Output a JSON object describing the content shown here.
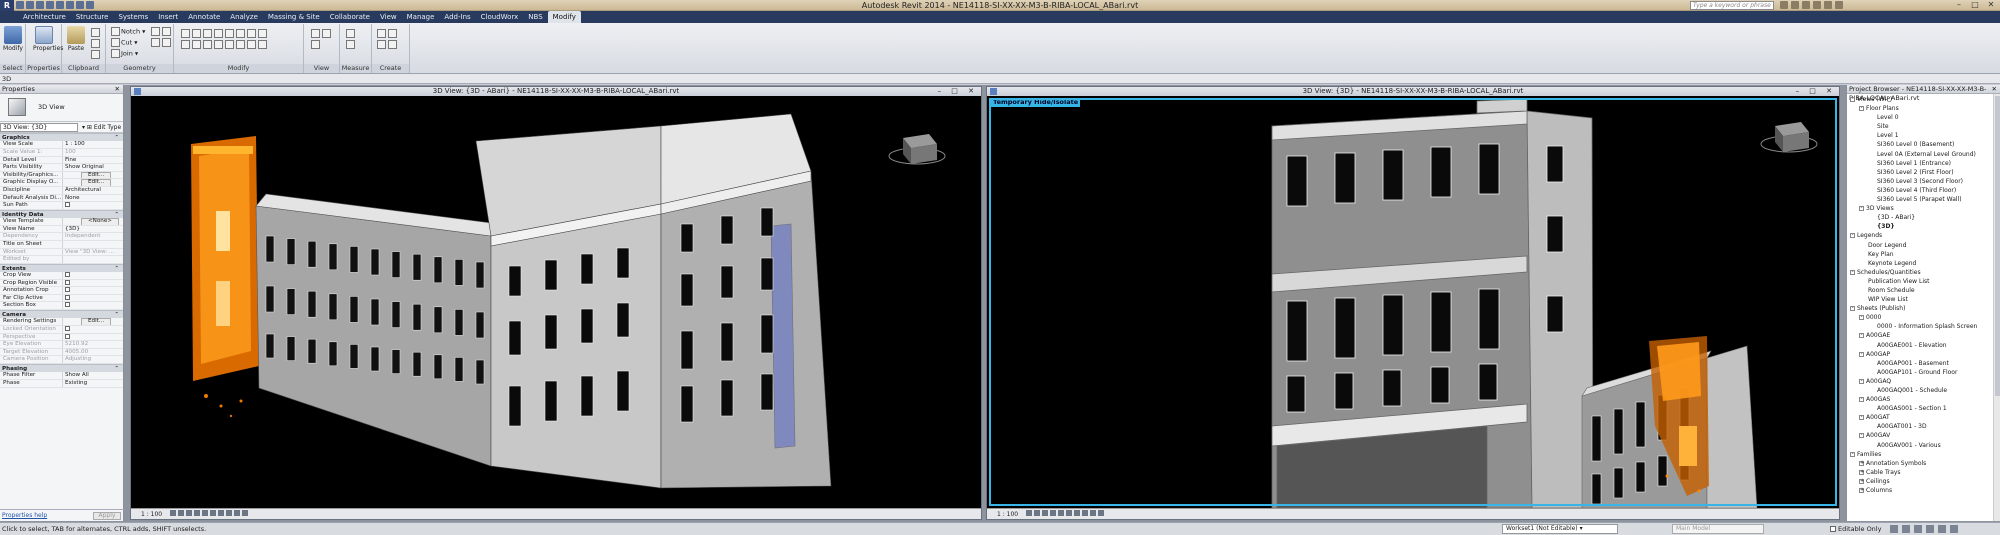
{
  "app": {
    "title": "Autodesk Revit 2014 -   NE14118-SI-XX-XX-M3-B-RIBA-LOCAL_ABari.rvt",
    "logo": "R",
    "help_search_placeholder": "Type a keyword or phrase"
  },
  "ribbon": {
    "tabs": [
      "Architecture",
      "Structure",
      "Systems",
      "Insert",
      "Annotate",
      "Analyze",
      "Massing & Site",
      "Collaborate",
      "View",
      "Manage",
      "Add-Ins",
      "CloudWorx",
      "NBS",
      "Modify"
    ],
    "active_tab": "Modify",
    "groups": {
      "select": "Select",
      "properties": "Properties",
      "clipboard": "Clipboard",
      "geometry": "Geometry",
      "modify": "Modify",
      "view": "View",
      "measure": "Measure",
      "create": "Create"
    },
    "buttons": {
      "modify": "Modify",
      "properties": "Properties",
      "paste": "Paste",
      "notch": "Notch",
      "cut": "Cut",
      "join": "Join"
    }
  },
  "context_bar": {
    "label": "3D"
  },
  "properties": {
    "header": "Properties",
    "type_name": "3D View",
    "instance_selector": "3D View: {3D}",
    "edit_type": "Edit Type",
    "sections": [
      {
        "name": "Graphics",
        "rows": [
          [
            "View Scale",
            "1 : 100"
          ],
          [
            "Scale Value    1:",
            "100"
          ],
          [
            "Detail Level",
            "Fine"
          ],
          [
            "Parts Visibility",
            "Show Original"
          ],
          [
            "Visibility/Graphics...",
            "Edit..."
          ],
          [
            "Graphic Display O...",
            "Edit..."
          ],
          [
            "Discipline",
            "Architectural"
          ],
          [
            "Default Analysis Di...",
            "None"
          ],
          [
            "Sun Path",
            ""
          ]
        ]
      },
      {
        "name": "Identity Data",
        "rows": [
          [
            "View Template",
            "<None>"
          ],
          [
            "View Name",
            "{3D}"
          ],
          [
            "Dependency",
            "Independent"
          ],
          [
            "Title on Sheet",
            ""
          ],
          [
            "Workset",
            "View \"3D View: ..."
          ],
          [
            "Edited by",
            ""
          ]
        ]
      },
      {
        "name": "Extents",
        "rows": [
          [
            "Crop View",
            ""
          ],
          [
            "Crop Region Visible",
            ""
          ],
          [
            "Annotation Crop",
            ""
          ],
          [
            "Far Clip Active",
            ""
          ],
          [
            "Section Box",
            ""
          ]
        ]
      },
      {
        "name": "Camera",
        "rows": [
          [
            "Rendering Settings",
            "Edit..."
          ],
          [
            "Locked Orientation",
            ""
          ],
          [
            "Perspective",
            ""
          ],
          [
            "Eye Elevation",
            "5210.92"
          ],
          [
            "Target Elevation",
            "4005.00"
          ],
          [
            "Camera Position",
            "Adjusting"
          ]
        ]
      },
      {
        "name": "Phasing",
        "rows": [
          [
            "Phase Filter",
            "Show All"
          ],
          [
            "Phase",
            "Existing"
          ]
        ]
      }
    ],
    "help_link": "Properties help",
    "apply": "Apply"
  },
  "views": {
    "left": {
      "title": "3D View: {3D - ABari} - NE14118-SI-XX-XX-M3-B-RIBA-LOCAL_ABari.rvt",
      "scale": "1 : 100"
    },
    "right": {
      "title": "3D View: {3D} - NE14118-SI-XX-XX-M3-B-RIBA-LOCAL_ABari.rvt",
      "scale": "1 : 100",
      "badge": "Temporary Hide/Isolate"
    }
  },
  "project_browser": {
    "header": "Project Browser - NE14118-SI-XX-XX-M3-B-RIBA-LOCAL_ABari.rvt",
    "items": [
      {
        "label": "Views (WIP)",
        "level": 0,
        "toggle": "-"
      },
      {
        "label": "Floor Plans",
        "level": 1,
        "toggle": "-"
      },
      {
        "label": "Level 0",
        "level": 2
      },
      {
        "label": "Site",
        "level": 2
      },
      {
        "label": "Level 1",
        "level": 2
      },
      {
        "label": "SI360 Level 0 (Basement)",
        "level": 2
      },
      {
        "label": "Level 0A (External Level Ground)",
        "level": 2
      },
      {
        "label": "SI360 Level 1 (Entrance)",
        "level": 2
      },
      {
        "label": "SI360 Level 2 (First Floor)",
        "level": 2
      },
      {
        "label": "SI360 Level 3 (Second Floor)",
        "level": 2
      },
      {
        "label": "SI360 Level 4 (Third Floor)",
        "level": 2
      },
      {
        "label": "SI360 Level 5 (Parapet Wall)",
        "level": 2
      },
      {
        "label": "3D Views",
        "level": 1,
        "toggle": "-"
      },
      {
        "label": "{3D - ABari}",
        "level": 2
      },
      {
        "label": "{3D}",
        "level": 2,
        "bold": true
      },
      {
        "label": "Legends",
        "level": 0,
        "toggle": "-"
      },
      {
        "label": "Door Legend",
        "level": 1
      },
      {
        "label": "Key Plan",
        "level": 1
      },
      {
        "label": "Keynote Legend",
        "level": 1
      },
      {
        "label": "Schedules/Quantities",
        "level": 0,
        "toggle": "-"
      },
      {
        "label": "Publication View List",
        "level": 1
      },
      {
        "label": "Room Schedule",
        "level": 1
      },
      {
        "label": "WIP View List",
        "level": 1
      },
      {
        "label": "Sheets (Publish)",
        "level": 0,
        "toggle": "-"
      },
      {
        "label": "0000",
        "level": 1,
        "toggle": "-"
      },
      {
        "label": "0000 - Information Splash Screen",
        "level": 2
      },
      {
        "label": "A00GAE",
        "level": 1,
        "toggle": "-"
      },
      {
        "label": "A00GAE001 - Elevation",
        "level": 2
      },
      {
        "label": "A00GAP",
        "level": 1,
        "toggle": "-"
      },
      {
        "label": "A00GAP001 - Basement",
        "level": 2
      },
      {
        "label": "A00GAP101 - Ground Floor",
        "level": 2
      },
      {
        "label": "A00GAQ",
        "level": 1,
        "toggle": "-"
      },
      {
        "label": "A00GAQ001 - Schedule",
        "level": 2
      },
      {
        "label": "A00GAS",
        "level": 1,
        "toggle": "-"
      },
      {
        "label": "A00GAS001 - Section 1",
        "level": 2
      },
      {
        "label": "A00GAT",
        "level": 1,
        "toggle": "-"
      },
      {
        "label": "A00GAT001 - 3D",
        "level": 2
      },
      {
        "label": "A00GAV",
        "level": 1,
        "toggle": "-"
      },
      {
        "label": "A00GAV001 - Various",
        "level": 2
      },
      {
        "label": "Families",
        "level": 0,
        "toggle": "-"
      },
      {
        "label": "Annotation Symbols",
        "level": 1,
        "toggle": "+"
      },
      {
        "label": "Cable Trays",
        "level": 1,
        "toggle": "+"
      },
      {
        "label": "Ceilings",
        "level": 1,
        "toggle": "+"
      },
      {
        "label": "Columns",
        "level": 1,
        "toggle": "+"
      }
    ]
  },
  "status": {
    "message": "Click to select, TAB for alternates, CTRL adds, SHIFT unselects.",
    "workset": "Workset1 (Not Editable)",
    "main_model": "Main Model",
    "editable_only": "Editable Only",
    "editable_count": ":0"
  },
  "colors": {
    "ribbon_tab_bg": "#283a5e",
    "active_view_border": "#35b6e6",
    "canvas_bg": "#000000",
    "point_cloud": "#ff8a00"
  }
}
